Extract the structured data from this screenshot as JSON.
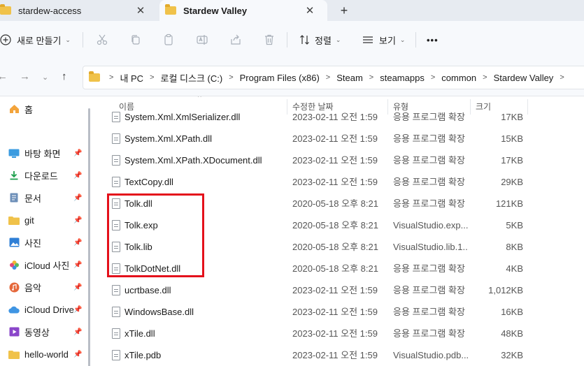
{
  "tabs": [
    {
      "label": "stardew-access",
      "close": "✕"
    },
    {
      "label": "Stardew Valley",
      "close": "✕"
    }
  ],
  "new_tab": "+",
  "toolbar": {
    "new_label": "새로 만들기",
    "sort_label": "정렬",
    "view_label": "보기",
    "more": "•••"
  },
  "address": {
    "crumbs": [
      "내 PC",
      "로컬 디스크 (C:)",
      "Program Files (x86)",
      "Steam",
      "steamapps",
      "common",
      "Stardew Valley"
    ]
  },
  "sidebar": {
    "items": [
      {
        "label": "홈",
        "icon": "home-icon",
        "pinned": false
      },
      {
        "label": "바탕 화면",
        "icon": "desktop-icon",
        "pinned": true
      },
      {
        "label": "다운로드",
        "icon": "download-icon",
        "pinned": true
      },
      {
        "label": "문서",
        "icon": "document-icon",
        "pinned": true
      },
      {
        "label": "git",
        "icon": "folder-icon",
        "pinned": true
      },
      {
        "label": "사진",
        "icon": "pictures-icon",
        "pinned": true
      },
      {
        "label": "iCloud 사진",
        "icon": "icloud-photos-icon",
        "pinned": true
      },
      {
        "label": "음악",
        "icon": "music-icon",
        "pinned": true
      },
      {
        "label": "iCloud Drive",
        "icon": "icloud-drive-icon",
        "pinned": true
      },
      {
        "label": "동영상",
        "icon": "video-icon",
        "pinned": true
      },
      {
        "label": "hello-world",
        "icon": "folder-icon",
        "pinned": true
      }
    ]
  },
  "columns": {
    "name": "이름",
    "date": "수정한 날짜",
    "type": "유형",
    "size": "크기"
  },
  "files": [
    {
      "name": "System.Xml.XmlSerializer.dll",
      "date": "2023-02-11 오전 1:59",
      "type": "응용 프로그램 확장",
      "size": "17KB"
    },
    {
      "name": "System.Xml.XPath.dll",
      "date": "2023-02-11 오전 1:59",
      "type": "응용 프로그램 확장",
      "size": "15KB"
    },
    {
      "name": "System.Xml.XPath.XDocument.dll",
      "date": "2023-02-11 오전 1:59",
      "type": "응용 프로그램 확장",
      "size": "17KB"
    },
    {
      "name": "TextCopy.dll",
      "date": "2023-02-11 오전 1:59",
      "type": "응용 프로그램 확장",
      "size": "29KB"
    },
    {
      "name": "Tolk.dll",
      "date": "2020-05-18 오후 8:21",
      "type": "응용 프로그램 확장",
      "size": "121KB"
    },
    {
      "name": "Tolk.exp",
      "date": "2020-05-18 오후 8:21",
      "type": "VisualStudio.exp....",
      "size": "5KB"
    },
    {
      "name": "Tolk.lib",
      "date": "2020-05-18 오후 8:21",
      "type": "VisualStudio.lib.1...",
      "size": "8KB"
    },
    {
      "name": "TolkDotNet.dll",
      "date": "2020-05-18 오후 8:21",
      "type": "응용 프로그램 확장",
      "size": "4KB"
    },
    {
      "name": "ucrtbase.dll",
      "date": "2023-02-11 오전 1:59",
      "type": "응용 프로그램 확장",
      "size": "1,012KB"
    },
    {
      "name": "WindowsBase.dll",
      "date": "2023-02-11 오전 1:59",
      "type": "응용 프로그램 확장",
      "size": "16KB"
    },
    {
      "name": "xTile.dll",
      "date": "2023-02-11 오전 1:59",
      "type": "응용 프로그램 확장",
      "size": "48KB"
    },
    {
      "name": "xTile.pdb",
      "date": "2023-02-11 오전 1:59",
      "type": "VisualStudio.pdb....",
      "size": "32KB"
    }
  ],
  "colors": {
    "highlight": "#e4101b",
    "folder": "#f0c24a",
    "chrome": "#f7f9fc"
  }
}
